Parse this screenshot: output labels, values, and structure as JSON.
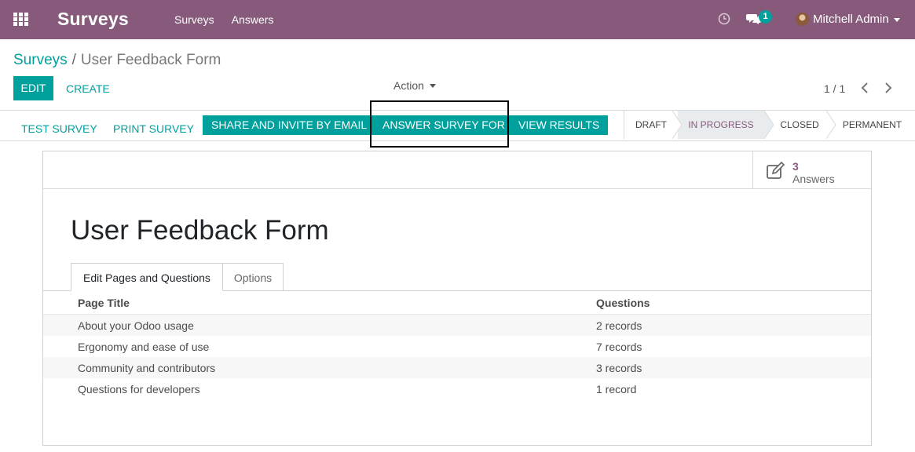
{
  "navbar": {
    "brand": "Surveys",
    "menu": [
      "Surveys",
      "Answers"
    ],
    "chat_count": "1",
    "user_name": "Mitchell Admin"
  },
  "breadcrumb": {
    "parent": "Surveys",
    "separator": "/",
    "current": "User Feedback Form"
  },
  "control_panel": {
    "edit_label": "EDIT",
    "create_label": "CREATE",
    "action_label": "Action",
    "pager": "1 / 1"
  },
  "header_buttons": {
    "test_survey": "TEST SURVEY",
    "print_survey": "PRINT SURVEY",
    "share_invite": "SHARE AND INVITE BY EMAIL",
    "answer_survey_for": "ANSWER SURVEY FOR",
    "view_results": "VIEW RESULTS"
  },
  "statusbar": {
    "stages": [
      "DRAFT",
      "IN PROGRESS",
      "CLOSED",
      "PERMANENT"
    ],
    "active": "IN PROGRESS"
  },
  "stat_button": {
    "value": "3",
    "label": "Answers"
  },
  "form": {
    "title": "User Feedback Form",
    "tabs": [
      "Edit Pages and Questions",
      "Options"
    ],
    "active_tab": "Edit Pages and Questions"
  },
  "table": {
    "columns": [
      "Page Title",
      "Questions"
    ],
    "rows": [
      [
        "About your Odoo usage",
        "2 records"
      ],
      [
        "Ergonomy and ease of use",
        "7 records"
      ],
      [
        "Community and contributors",
        "3 records"
      ],
      [
        "Questions for developers",
        "1 record"
      ]
    ]
  },
  "colors": {
    "brand": "#875a7b",
    "primary": "#00a09d"
  }
}
